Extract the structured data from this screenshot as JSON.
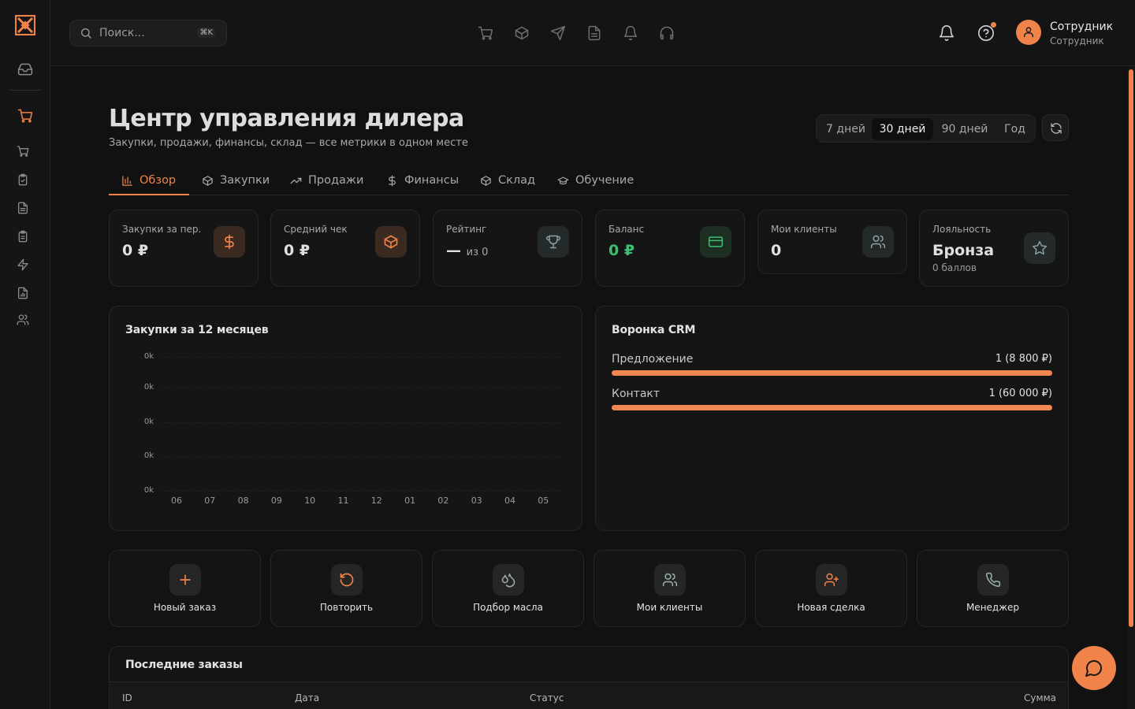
{
  "header": {
    "search_placeholder": "Поиск...",
    "search_shortcut": "⌘K",
    "user_name": "Сотрудник",
    "user_role": "Сотрудник"
  },
  "page": {
    "title": "Центр управления дилера",
    "subtitle": "Закупки, продажи, финансы, склад — все метрики в одном месте"
  },
  "periods": [
    "7 дней",
    "30 дней",
    "90 дней",
    "Год"
  ],
  "selected_period": "30 дней",
  "tabs": [
    "Обзор",
    "Закупки",
    "Продажи",
    "Финансы",
    "Склад",
    "Обучение"
  ],
  "active_tab": "Обзор",
  "stats": [
    {
      "label": "Закупки за пер...",
      "value": "0 ₽",
      "icon": "dollar-icon"
    },
    {
      "label": "Средний чек",
      "value": "0 ₽",
      "icon": "box-icon"
    },
    {
      "label": "Рейтинг",
      "value": "—",
      "value_suffix": "из 0",
      "icon": "trophy-icon"
    },
    {
      "label": "Баланс",
      "value": "0 ₽",
      "icon": "card-icon"
    },
    {
      "label": "Мои клиенты",
      "value": "0",
      "icon": "users-icon"
    },
    {
      "label": "Лояльность",
      "value": "Бронза",
      "sub": "0 баллов",
      "icon": "star-icon"
    }
  ],
  "chart_panel": {
    "title": "Закупки за 12 месяцев"
  },
  "chart_data": {
    "type": "bar",
    "title": "Закупки за 12 месяцев",
    "categories": [
      "06",
      "07",
      "08",
      "09",
      "10",
      "11",
      "12",
      "01",
      "02",
      "03",
      "04",
      "05"
    ],
    "values": [
      0,
      0,
      0,
      0,
      0,
      0,
      0,
      0,
      0,
      0,
      0,
      0
    ],
    "yticks": [
      "0k",
      "0k",
      "0k",
      "0k",
      "0k"
    ],
    "grid": true
  },
  "funnel": {
    "title": "Воронка CRM",
    "items": [
      {
        "label": "Предложение",
        "value": "1 (8 800 ₽)",
        "fill": 1.0
      },
      {
        "label": "Контакт",
        "value": "1 (60 000 ₽)",
        "fill": 1.0
      }
    ]
  },
  "actions": [
    {
      "label": "Новый заказ",
      "icon": "plus-icon"
    },
    {
      "label": "Повторить",
      "icon": "repeat-icon"
    },
    {
      "label": "Подбор масла",
      "icon": "droplets-icon"
    },
    {
      "label": "Мои клиенты",
      "icon": "users-icon"
    },
    {
      "label": "Новая сделка",
      "icon": "user-plus-icon"
    },
    {
      "label": "Менеджер",
      "icon": "phone-icon"
    }
  ],
  "orders": {
    "title": "Последние заказы",
    "columns": [
      "ID",
      "Дата",
      "Статус",
      "Сумма"
    ]
  },
  "colors": {
    "accent": "#f0834a",
    "background": "#111111",
    "card": "#151515",
    "positive": "#3cc070"
  }
}
